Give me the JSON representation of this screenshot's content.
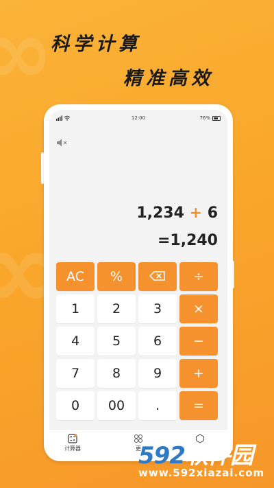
{
  "hero": {
    "line1": "科学计算",
    "line2": "精准高效"
  },
  "status_bar": {
    "time": "12:00",
    "battery": "76%"
  },
  "display": {
    "operand1": "1,234",
    "operator": "+",
    "operand2": "6",
    "result": "=1,240"
  },
  "keys": [
    {
      "label": "AC",
      "style": "orange"
    },
    {
      "label": "%",
      "style": "orange"
    },
    {
      "label": "",
      "style": "orange",
      "icon": "backspace-icon"
    },
    {
      "label": "÷",
      "style": "orange"
    },
    {
      "label": "1",
      "style": "white"
    },
    {
      "label": "2",
      "style": "white"
    },
    {
      "label": "3",
      "style": "white"
    },
    {
      "label": "×",
      "style": "orange"
    },
    {
      "label": "4",
      "style": "white"
    },
    {
      "label": "5",
      "style": "white"
    },
    {
      "label": "6",
      "style": "white"
    },
    {
      "label": "−",
      "style": "orange"
    },
    {
      "label": "7",
      "style": "white"
    },
    {
      "label": "8",
      "style": "white"
    },
    {
      "label": "9",
      "style": "white"
    },
    {
      "label": "+",
      "style": "orange"
    },
    {
      "label": "0",
      "style": "white"
    },
    {
      "label": "00",
      "style": "white"
    },
    {
      "label": ".",
      "style": "white"
    },
    {
      "label": "=",
      "style": "orange"
    }
  ],
  "tabbar": {
    "tab1": "计算器",
    "tab2": "更",
    "tab3": ""
  },
  "watermark": {
    "brand_num": "592",
    "brand_text": "软件园",
    "url": "www.592xiazai.com"
  },
  "colors": {
    "accent": "#f6922e",
    "background": "#f9a72b",
    "watermark_blue": "#2f7ac6"
  }
}
